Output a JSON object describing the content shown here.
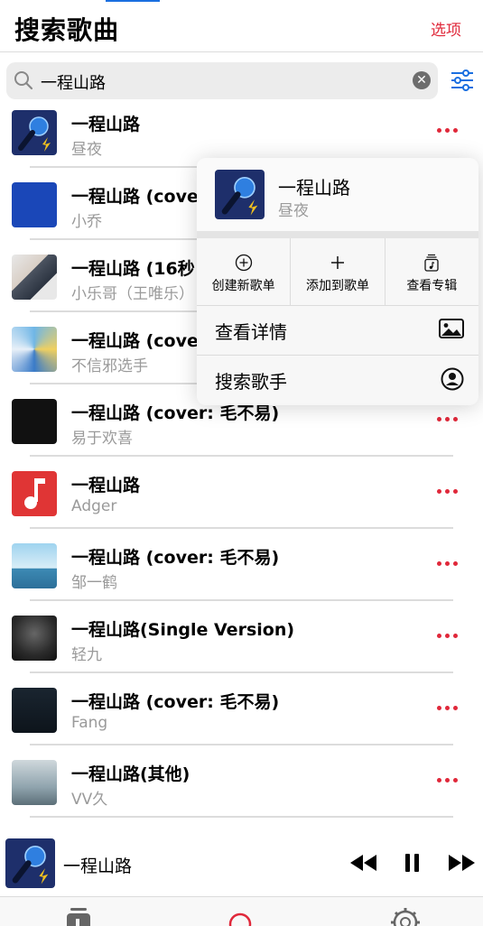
{
  "header": {
    "title": "搜索歌曲",
    "options_label": "选项"
  },
  "search": {
    "query": "一程山路",
    "placeholder": ""
  },
  "songs": [
    {
      "title": "一程山路",
      "artist": "昼夜",
      "art": "mic"
    },
    {
      "title": "一程山路 (cove",
      "artist": "小乔",
      "art": "blue"
    },
    {
      "title": "一程山路 (16秒",
      "artist": "小乐哥（王唯乐）",
      "art": "person"
    },
    {
      "title": "一程山路 (cove",
      "artist": "不信邪选手",
      "art": "mosaic"
    },
    {
      "title": "一程山路 (cover: 毛不易)",
      "artist": "易于欢喜",
      "art": "dark"
    },
    {
      "title": "一程山路",
      "artist": "Adger",
      "art": "note"
    },
    {
      "title": "一程山路 (cover: 毛不易)",
      "artist": "邹一鹤",
      "art": "sky"
    },
    {
      "title": "一程山路(Single Version)",
      "artist": "轻九",
      "art": "night"
    },
    {
      "title": "一程山路 (cover: 毛不易)",
      "artist": "Fang",
      "art": "city"
    },
    {
      "title": "一程山路(其他)",
      "artist": "VV久",
      "art": "fog"
    }
  ],
  "popup": {
    "title": "一程山路",
    "artist": "昼夜",
    "actions": [
      {
        "label": "创建新歌单",
        "icon": "circle-plus-icon"
      },
      {
        "label": "添加到歌单",
        "icon": "plus-icon"
      },
      {
        "label": "查看专辑",
        "icon": "album-icon"
      }
    ],
    "details_label": "查看详情",
    "search_artist_label": "搜索歌手"
  },
  "player": {
    "title": "一程山路"
  },
  "colors": {
    "accent": "#e0283a",
    "link": "#1a6fe0"
  }
}
